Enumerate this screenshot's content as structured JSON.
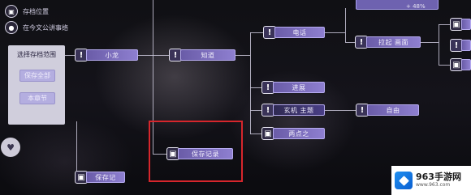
{
  "top_left": {
    "save_label": "存档位置",
    "chapter_label": "在今文公讲事络"
  },
  "panel": {
    "title": "选择存档范围",
    "btn1": "保存全部",
    "btn2": "本章节"
  },
  "nodes": {
    "xiaoxue": "小龙",
    "zhidao": "知道",
    "dianhua": "电话",
    "huayi": "拉起 画面",
    "jinzhan": "进展",
    "xuanji": "玄机 主题",
    "ziyou": "自由",
    "liangzhi": "两点之",
    "baocun": "保存记录",
    "bottom": "保存记"
  },
  "icon_glyph": "!",
  "zoom_text": "+ 48%",
  "watermark": {
    "brand": "963手游网",
    "site": "www.963.com"
  },
  "highlight_color": "#d6262c",
  "accent_color": "#8e7fd0"
}
